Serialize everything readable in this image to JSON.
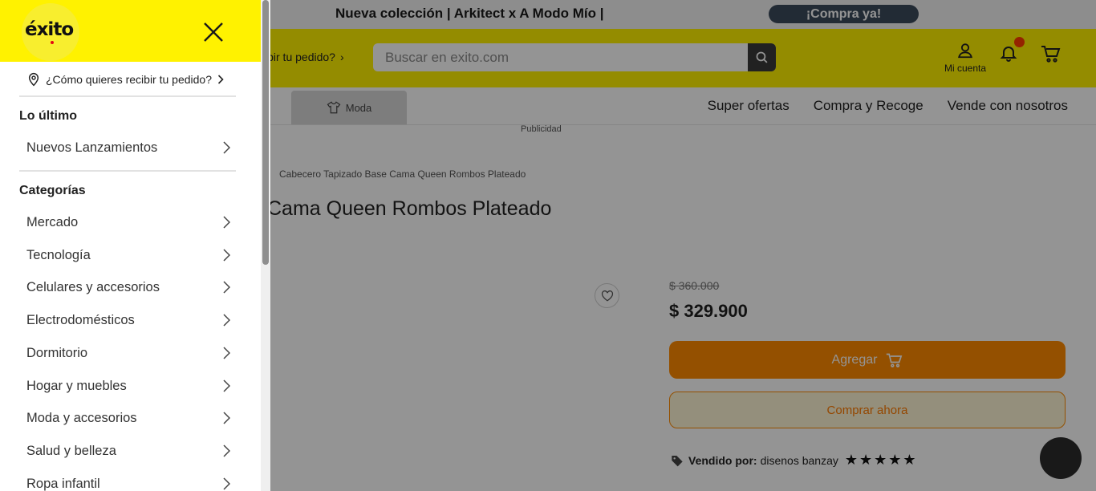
{
  "promo": {
    "text": "Nueva colección | Arkitect x A Modo Mío |",
    "cta": "¡Compra ya!"
  },
  "header": {
    "delivery_partial": "ibir tu pedido?",
    "search_placeholder": "Buscar en exito.com",
    "account_label": "Mi cuenta"
  },
  "nav": {
    "moda_label": "Moda",
    "links": [
      "Super ofertas",
      "Compra y Recoge",
      "Vende con nosotros"
    ]
  },
  "ad_label": "Publicidad",
  "product": {
    "breadcrumb": "Cabecero Tapizado Base Cama Queen Rombos Plateado",
    "title_partial": "Cama Queen Rombos Plateado",
    "old_price": "$ 360.000",
    "price": "$ 329.900",
    "add_label": "Agregar",
    "buy_label": "Comprar ahora",
    "seller_label": "Vendido por:",
    "seller_name": "disenos banzay",
    "stars": "★★★★★"
  },
  "drawer": {
    "logo": "éxito",
    "delivery_question": "¿Cómo quieres recibir tu pedido?",
    "latest_title": "Lo último",
    "latest_items": [
      "Nuevos Lanzamientos"
    ],
    "categories_title": "Categorías",
    "categories": [
      "Mercado",
      "Tecnología",
      "Celulares y accesorios",
      "Electrodomésticos",
      "Dormitorio",
      "Hogar y muebles",
      "Moda y accesorios",
      "Salud y belleza",
      "Ropa infantil"
    ]
  },
  "colors": {
    "brand_yellow": "#fff200",
    "accent_orange": "#ff8a00",
    "overlay": "rgba(0,0,0,0.42)"
  },
  "icons": [
    "close-icon",
    "location-pin-icon",
    "chevron-right-icon",
    "search-icon",
    "user-icon",
    "bell-icon",
    "cart-icon",
    "heart-icon",
    "tag-icon",
    "shirt-icon"
  ]
}
